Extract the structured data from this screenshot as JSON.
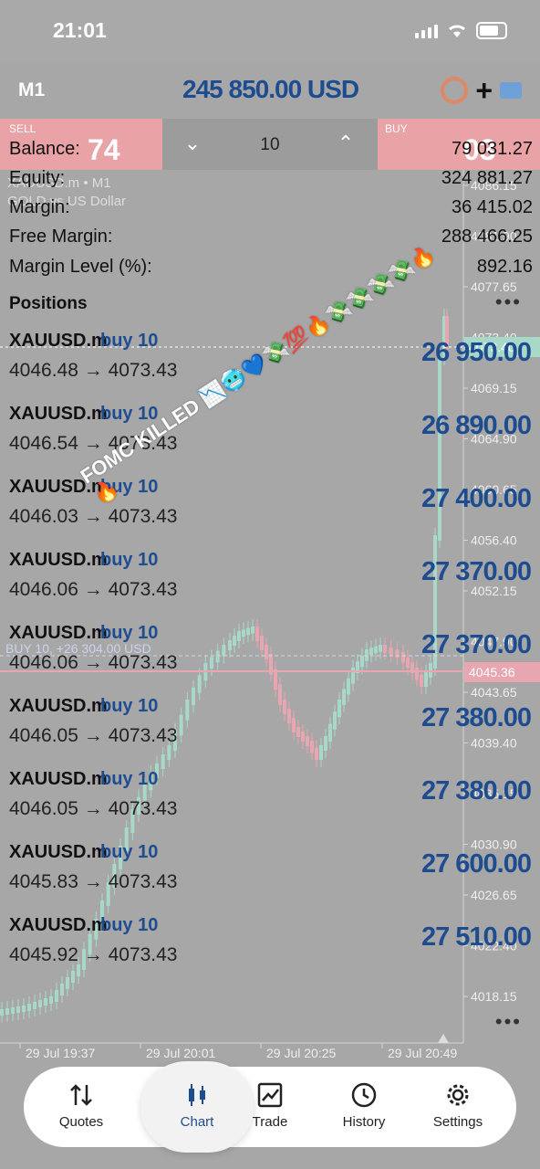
{
  "status_bar": {
    "time": "21:01"
  },
  "toolbar": {
    "timeframe": "M1",
    "profit_total": "245 850.00 USD"
  },
  "trade_panel": {
    "sell_label": "SELL",
    "sell_price": "74",
    "buy_label": "BUY",
    "buy_price": "03",
    "volume": "10",
    "volume_down_icon": "chevron-down",
    "volume_up_icon": "chevron-up"
  },
  "chart": {
    "symbol": "XAUUSD.m • M1",
    "description": "GOLD vs US Dollar",
    "price_axis": [
      "4086.15",
      "4081.90",
      "4077.65",
      "4073.40",
      "4069.15",
      "4064.90",
      "4060.65",
      "4056.40",
      "4052.15",
      "4047.90",
      "4043.65",
      "4039.40",
      "4035.15",
      "4030.90",
      "4026.65",
      "4022.40",
      "4018.15"
    ],
    "current_bid_tag": "4073.40",
    "position_line_tag": "4045.36",
    "position_line_label": "BUY 10, +26 304.00 USD",
    "time_axis": [
      "29 Jul 19:37",
      "29 Jul 20:01",
      "29 Jul 20:25",
      "29 Jul 20:49"
    ],
    "colors": {
      "bull": "#a8d8c8",
      "bear": "#e8a7b0",
      "accent": "#1e4d8f"
    }
  },
  "account": {
    "rows": [
      {
        "key": "Balance:",
        "value": "79 031.27"
      },
      {
        "key": "Equity:",
        "value": "324 881.27"
      },
      {
        "key": "Margin:",
        "value": "36 415.02"
      },
      {
        "key": "Free Margin:",
        "value": "288 466.25"
      },
      {
        "key": "Margin Level (%):",
        "value": "892.16"
      }
    ]
  },
  "positions": {
    "title": "Positions",
    "items": [
      {
        "symbol": "XAUUSD.m",
        "dir": "buy 10",
        "prices": "4046.48 → 4073.43",
        "pl": "26 950.00"
      },
      {
        "symbol": "XAUUSD.m",
        "dir": "buy 10",
        "prices": "4046.54 → 4073.43",
        "pl": "26 890.00"
      },
      {
        "symbol": "XAUUSD.m",
        "dir": "buy 10",
        "prices": "4046.03 → 4073.43",
        "pl": "27 400.00"
      },
      {
        "symbol": "XAUUSD.m",
        "dir": "buy 10",
        "prices": "4046.06 → 4073.43",
        "pl": "27 370.00"
      },
      {
        "symbol": "XAUUSD.m",
        "dir": "buy 10",
        "prices": "4046.06 → 4073.43",
        "pl": "27 370.00"
      },
      {
        "symbol": "XAUUSD.m",
        "dir": "buy 10",
        "prices": "4046.05 → 4073.43",
        "pl": "27 380.00"
      },
      {
        "symbol": "XAUUSD.m",
        "dir": "buy 10",
        "prices": "4046.05 → 4073.43",
        "pl": "27 380.00"
      },
      {
        "symbol": "XAUUSD.m",
        "dir": "buy 10",
        "prices": "4045.83 → 4073.43",
        "pl": "27 600.00"
      },
      {
        "symbol": "XAUUSD.m",
        "dir": "buy 10",
        "prices": "4045.92 → 4073.43",
        "pl": "27 510.00"
      }
    ]
  },
  "sticker": {
    "text": "FOMC KILLED",
    "emojis": "📉🥶💙💸💯🔥💸💸💸💸🔥🔥"
  },
  "nav": [
    {
      "label": "Quotes",
      "icon": "quotes-icon"
    },
    {
      "label": "Chart",
      "icon": "chart-icon"
    },
    {
      "label": "Trade",
      "icon": "trade-icon"
    },
    {
      "label": "History",
      "icon": "history-icon"
    },
    {
      "label": "Settings",
      "icon": "settings-icon"
    }
  ]
}
